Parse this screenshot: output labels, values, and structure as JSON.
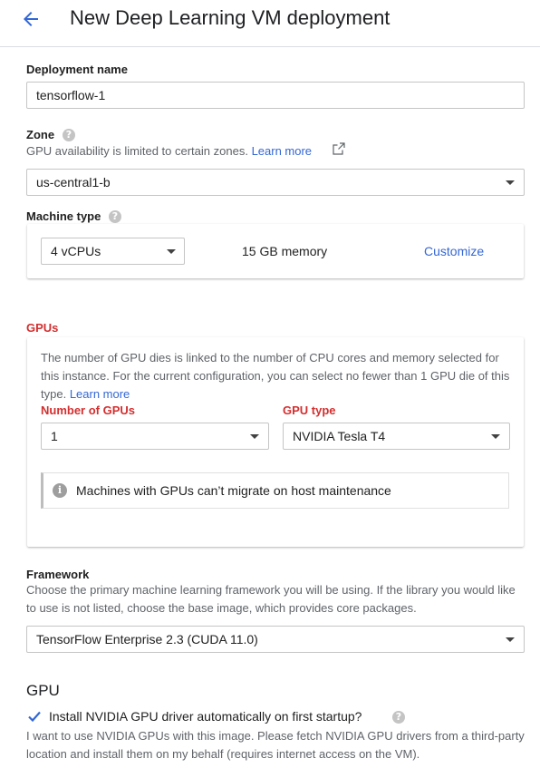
{
  "header": {
    "title": "New Deep Learning VM deployment"
  },
  "deployment": {
    "label": "Deployment name",
    "value": "tensorflow-1"
  },
  "zone": {
    "label": "Zone",
    "help": "?",
    "note": "GPU availability is limited to certain zones.",
    "link": "Learn more",
    "value": "us-central1-b"
  },
  "machine": {
    "label": "Machine type",
    "help": "?",
    "cpu_value": "4 vCPUs",
    "memory": "15 GB memory",
    "customize": "Customize"
  },
  "gpus": {
    "label": "GPUs",
    "description": "The number of GPU dies is linked to the number of CPU cores and memory selected for this instance. For the current configuration, you can select no fewer than 1 GPU die of this type.",
    "link": "Learn more",
    "count_label": "Number of GPUs",
    "count_value": "1",
    "type_label": "GPU type",
    "type_value": "NVIDIA Tesla T4",
    "info_icon": "i",
    "info": "Machines with GPUs can’t migrate on host maintenance"
  },
  "framework": {
    "label": "Framework",
    "description": "Choose the primary machine learning framework you will be using. If the library you would like to use is not listed, choose the base image, which provides core packages.",
    "value": "TensorFlow Enterprise 2.3 (CUDA 11.0)"
  },
  "gpu_section": {
    "title": "GPU",
    "checkbox_label": "Install NVIDIA GPU driver automatically on first startup?",
    "checked": true,
    "help": "?",
    "description": "I want to use NVIDIA GPUs with this image. Please fetch NVIDIA GPU drivers from a third-party location and install them on my behalf (requires internet access on the VM)."
  },
  "colors": {
    "accent": "#3367d6",
    "error": "#d32f2f",
    "text": "#212121",
    "secondary": "#5f6368"
  },
  "icons": {
    "back": "arrow-left-icon",
    "external": "external-link-icon",
    "dropdown": "caret-down-icon",
    "info": "info-icon",
    "check": "checkmark-icon",
    "help": "help-icon"
  }
}
